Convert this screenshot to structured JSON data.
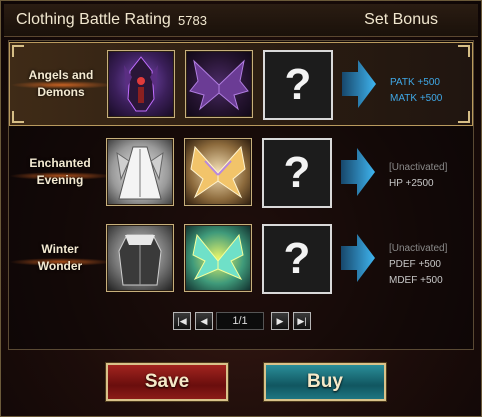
{
  "header": {
    "title": "Clothing Battle Rating",
    "rating": "5783",
    "set_bonus_label": "Set Bonus"
  },
  "sets": [
    {
      "name_line1": "Angels and",
      "name_line2": "Demons",
      "selected": true,
      "bonus_status": "",
      "bonus_lines": [
        "PATK +500",
        "MATK +500"
      ]
    },
    {
      "name_line1": "Enchanted",
      "name_line2": "Evening",
      "selected": false,
      "bonus_status": "[Unactivated]",
      "bonus_lines": [
        "HP +2500"
      ]
    },
    {
      "name_line1": "Winter",
      "name_line2": "Wonder",
      "selected": false,
      "bonus_status": "[Unactivated]",
      "bonus_lines": [
        "PDEF +500",
        "MDEF +500"
      ]
    }
  ],
  "unknown_slot_mark": "?",
  "pager": {
    "indicator": "1/1"
  },
  "buttons": {
    "save": "Save",
    "buy": "Buy"
  },
  "colors": {
    "active_bonus": "#3fa8e6",
    "inactive_bonus": "#8a8a8a",
    "save_button": "#a2241f",
    "buy_button": "#2a8e99"
  }
}
